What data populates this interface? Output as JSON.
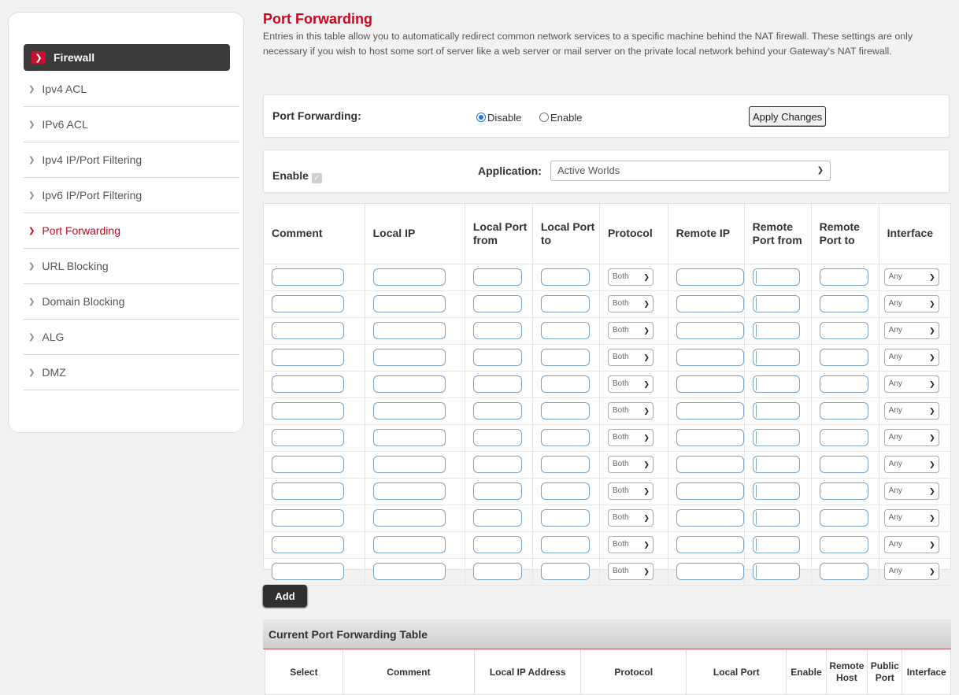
{
  "sidebar": {
    "header": "Firewall",
    "items": [
      {
        "label": "Ipv4 ACL"
      },
      {
        "label": "IPv6 ACL"
      },
      {
        "label": "Ipv4 IP/Port Filtering"
      },
      {
        "label": "Ipv6 IP/Port Filtering"
      },
      {
        "label": "Port Forwarding",
        "active": true
      },
      {
        "label": "URL Blocking"
      },
      {
        "label": "Domain Blocking"
      },
      {
        "label": "ALG"
      },
      {
        "label": "DMZ"
      }
    ]
  },
  "page": {
    "title": "Port Forwarding",
    "description": "Entries in this table allow you to automatically redirect common network services to a specific machine behind the NAT firewall. These settings are only necessary if you wish to host some sort of server like a web server or mail server on the private local network behind your Gateway's NAT firewall."
  },
  "settings": {
    "port_forwarding_label": "Port Forwarding:",
    "disable_label": "Disable",
    "enable_label": "Enable",
    "selected": "Disable",
    "apply_label": "Apply Changes"
  },
  "app_row": {
    "enable_label": "Enable",
    "application_label": "Application:",
    "application_value": "Active Worlds"
  },
  "entry_table": {
    "columns": [
      "Comment",
      "Local IP",
      "Local Port from",
      "Local Port to",
      "Protocol",
      "Remote IP",
      "Remote Port from",
      "Remote Port to",
      "Interface"
    ],
    "protocol_value": "Both",
    "interface_value": "Any",
    "row_count": 12
  },
  "add_label": "Add",
  "current_table": {
    "title": "Current Port Forwarding Table",
    "columns": [
      "Select",
      "Comment",
      "Local IP Address",
      "Protocol",
      "Local Port",
      "Enable",
      "Remote Host",
      "Public Port",
      "Interface"
    ]
  },
  "colors": {
    "accent": "#d0021b",
    "sidebar_header_bg": "#3a3a3a"
  }
}
